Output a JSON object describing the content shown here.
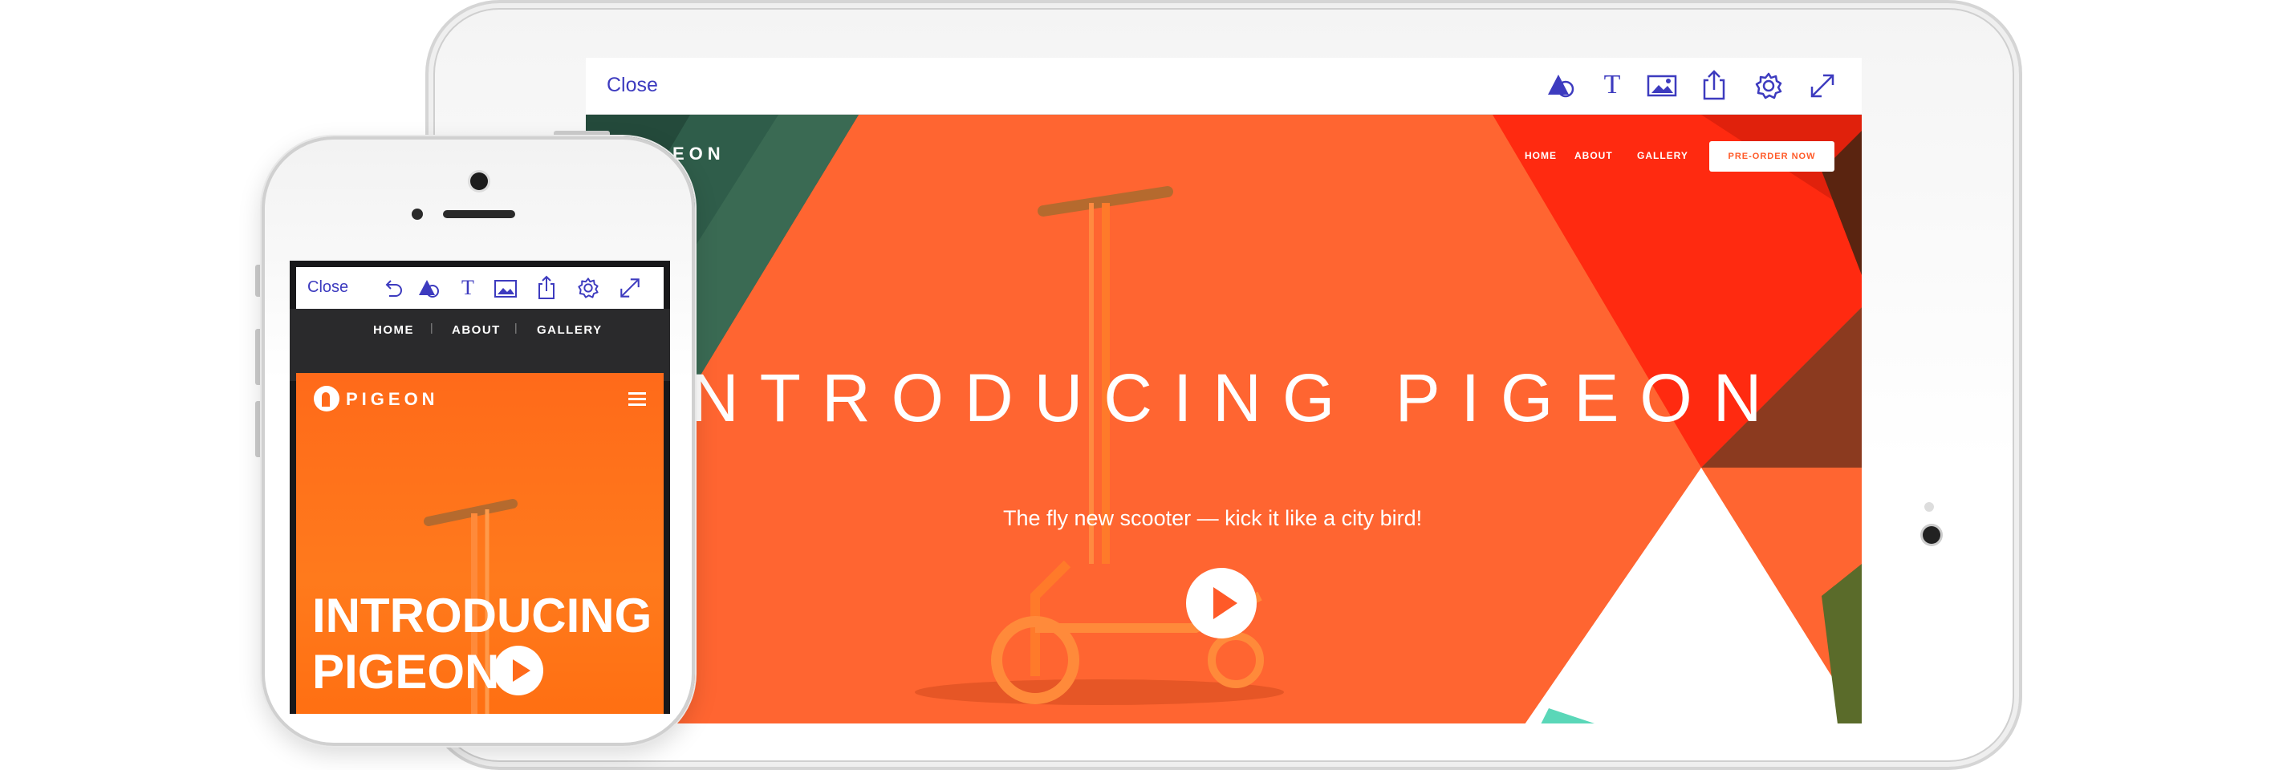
{
  "tablet": {
    "toolbar": {
      "close_label": "Close",
      "icons": [
        "shapes-icon",
        "text-icon",
        "image-icon",
        "share-icon",
        "gear-icon",
        "expand-icon"
      ],
      "text_icon_glyph": "T"
    },
    "site": {
      "logo": "PIGEON",
      "logo_visible": "EON",
      "nav": [
        "HOME",
        "ABOUT",
        "GALLERY"
      ],
      "cta": "PRE-ORDER NOW",
      "headline": "INTRODUCING PIGEON",
      "headline_visible": "NTRODUCING PIGEON",
      "subheadline": "The fly new scooter — kick it like a city bird!",
      "brand_color": "#ff6531"
    }
  },
  "phone": {
    "toolbar": {
      "close_label": "Close",
      "icons": [
        "undo-icon",
        "shapes-icon",
        "text-icon",
        "image-icon",
        "share-icon",
        "gear-icon",
        "expand-icon"
      ],
      "text_icon_glyph": "T"
    },
    "nav": [
      "HOME",
      "ABOUT",
      "GALLERY"
    ],
    "nav_separator": "|",
    "site": {
      "logo": "PIGEON",
      "headline_line1": "INTRODUCING",
      "headline_line2": "PIGEON",
      "brand_color": "#ff6a1a"
    }
  },
  "accent_color": "#3d3bbf"
}
